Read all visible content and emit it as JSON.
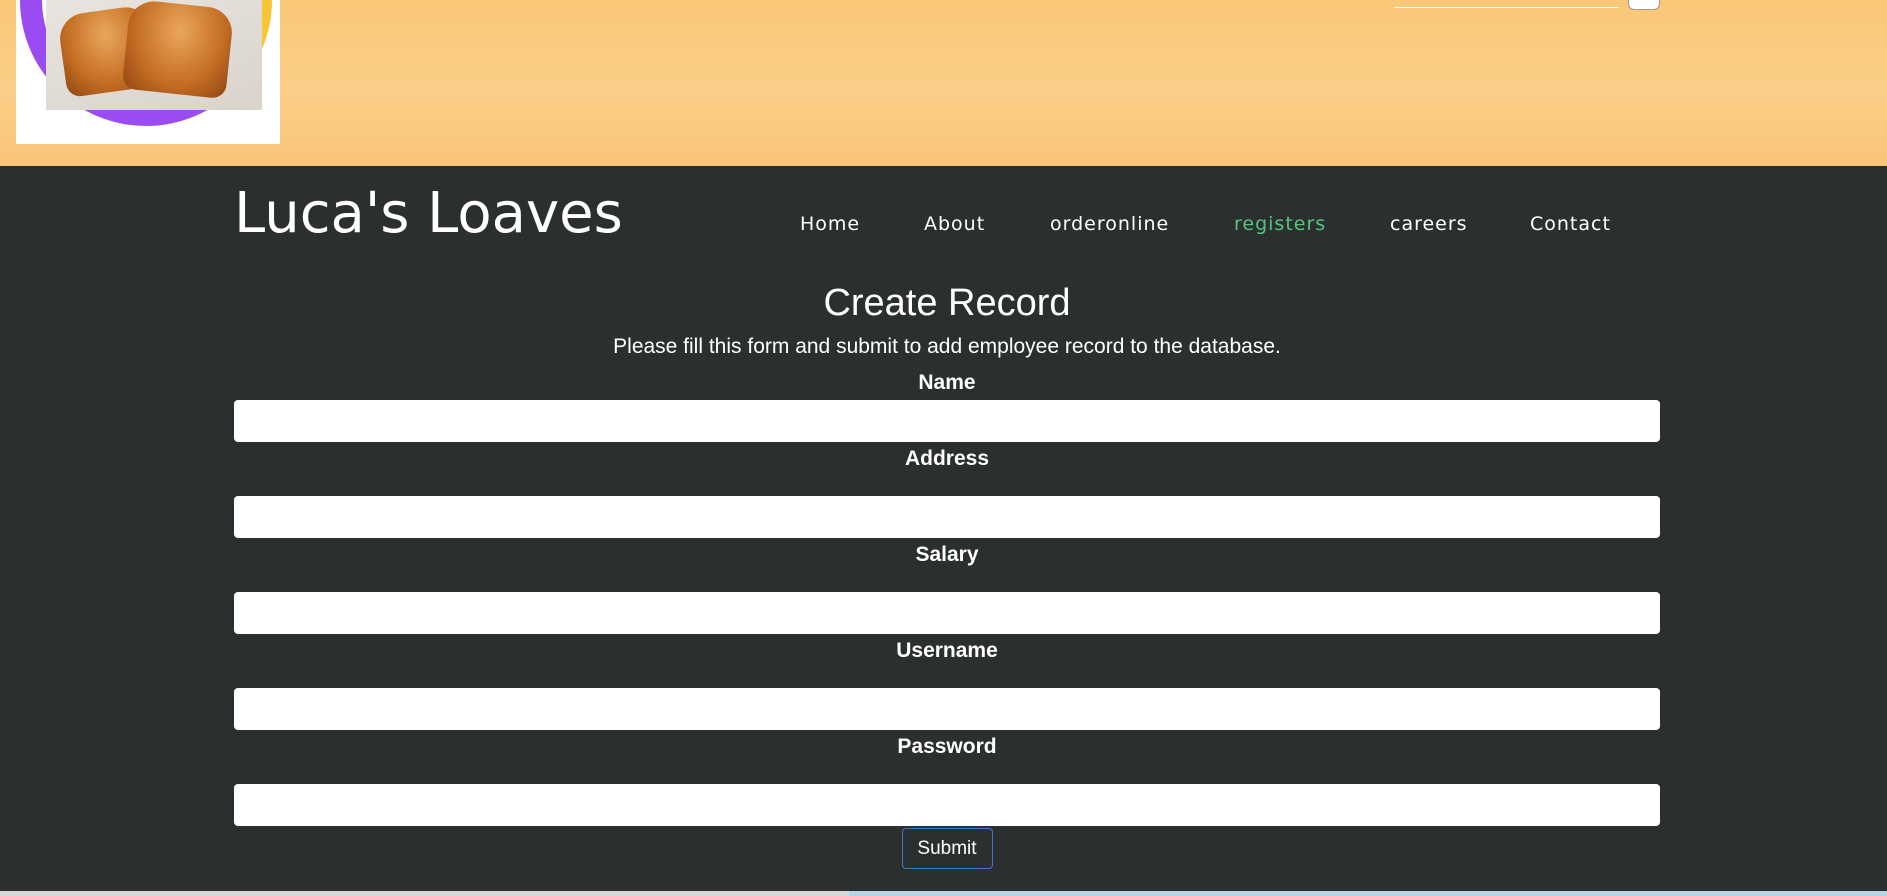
{
  "site": {
    "title": "Luca's Loaves"
  },
  "nav": {
    "items": [
      {
        "label": "Home",
        "active": false
      },
      {
        "label": "About",
        "active": false
      },
      {
        "label": "orderonline",
        "active": false
      },
      {
        "label": "registers",
        "active": true
      },
      {
        "label": "careers",
        "active": false
      },
      {
        "label": "Contact",
        "active": false
      }
    ]
  },
  "form": {
    "title": "Create Record",
    "description": "Please fill this form and submit to add employee record to the database.",
    "fields": [
      {
        "label": "Name",
        "value": ""
      },
      {
        "label": "Address",
        "value": ""
      },
      {
        "label": "Salary",
        "value": ""
      },
      {
        "label": "Username",
        "value": ""
      },
      {
        "label": "Password",
        "value": ""
      }
    ],
    "submit_label": "Submit"
  },
  "colors": {
    "header_bg": "#2b2f2f",
    "banner": "#fbcf88",
    "active_nav": "#57c47a",
    "submit_border": "#3b7bbf"
  }
}
